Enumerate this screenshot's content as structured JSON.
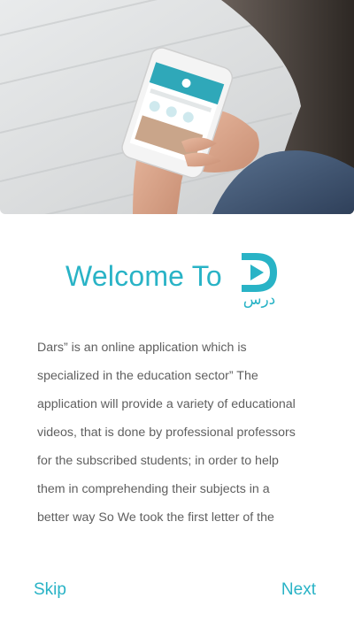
{
  "welcome": {
    "title": "Welcome To",
    "logo_text": "درس",
    "brand_color": "#29b3c6"
  },
  "hero": {
    "icon": "hero-photo-hands-holding-phone"
  },
  "description": {
    "lines": [
      "Dars” is an online application which is",
      "specialized in the education sector” The",
      "application will provide a variety of educational",
      "videos, that is done by professional professors",
      "for the subscribed students; in order to help",
      "them in comprehending their subjects in a",
      "better way So We took the first letter of the"
    ]
  },
  "nav": {
    "skip_label": "Skip",
    "next_label": "Next"
  }
}
